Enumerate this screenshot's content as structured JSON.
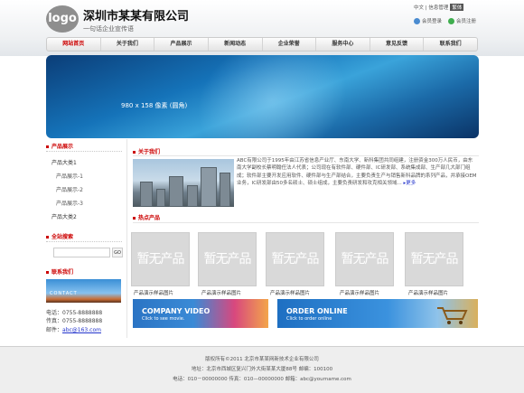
{
  "header": {
    "logo_text": "logo",
    "company_name": "深圳市某某有限公司",
    "slogan": "一句话企业宣传语",
    "lang_links": "中文 | 信息管理",
    "lang_button": "繁体",
    "login_label": "会员登录",
    "register_label": "会员注册"
  },
  "nav": {
    "items": [
      "网站首页",
      "关于我们",
      "产品展示",
      "新闻动态",
      "企业荣誉",
      "服务中心",
      "意见反馈",
      "联系我们"
    ],
    "active_index": 0
  },
  "banner": {
    "size_label": "980 x 158 像素 (圆角)"
  },
  "sidebar": {
    "products_title": "产品展示",
    "products": [
      {
        "label": "产品大类1"
      },
      {
        "label": "产品展示-1"
      },
      {
        "label": "产品展示-2"
      },
      {
        "label": "产品展示-3"
      },
      {
        "label": "产品大类2"
      }
    ],
    "search_title": "全站搜索",
    "search_button": "GO",
    "contact_title": "联系我们",
    "contact_image_label": "CONTACT",
    "phone": "电话：0755-8888888",
    "fax": "传真：0755-8888888",
    "email_label": "邮件：",
    "email": "abc@163.com"
  },
  "about": {
    "title": "关于我们",
    "text": "ABC有限公司于1995年由江苏省信息产业厅、东南大学、新科集团共同组建，注册资金300万人民币，由东南大学副校长蔡明翰任法人代表；公司现在有软件部、硬件部、IC研发部、系统集成部、生产部几大部门组成；软件部主要开发应用软件、硬件部与生产部结合，主要负责生产与销售新科品牌的系列产品，并承接OEM业务，IC研发部由50多名硕士、硕士组成，主要负责研发和攻克相关领域...",
    "more": "更多"
  },
  "hot_products": {
    "title": "热点产品",
    "placeholder": "暂无产品",
    "items": [
      {
        "caption": "产品演示样品图片"
      },
      {
        "caption": "产品演示样品图片"
      },
      {
        "caption": "产品演示样品图片"
      },
      {
        "caption": "产品演示样品图片"
      },
      {
        "caption": "产品演示样品图片"
      }
    ]
  },
  "promos": [
    {
      "title": "COMPANY VIDEO",
      "subtitle": "Click to see movie."
    },
    {
      "title": "ORDER ONLINE",
      "subtitle": "Click to order online"
    }
  ],
  "footer": {
    "copyright": "版权所有©2011 北京市某某网新技术企业有限公司",
    "address": "地址：北京市西城区复兴门外大街某某大厦88号     邮编：100100",
    "contact": "电话：010－00000000     传真：010—00000000     邮箱：abc@yourname.com"
  },
  "colors": {
    "accent": "#cc0000",
    "nav_bg": "#e8e8e8",
    "banner_blue": "#1573b9"
  }
}
